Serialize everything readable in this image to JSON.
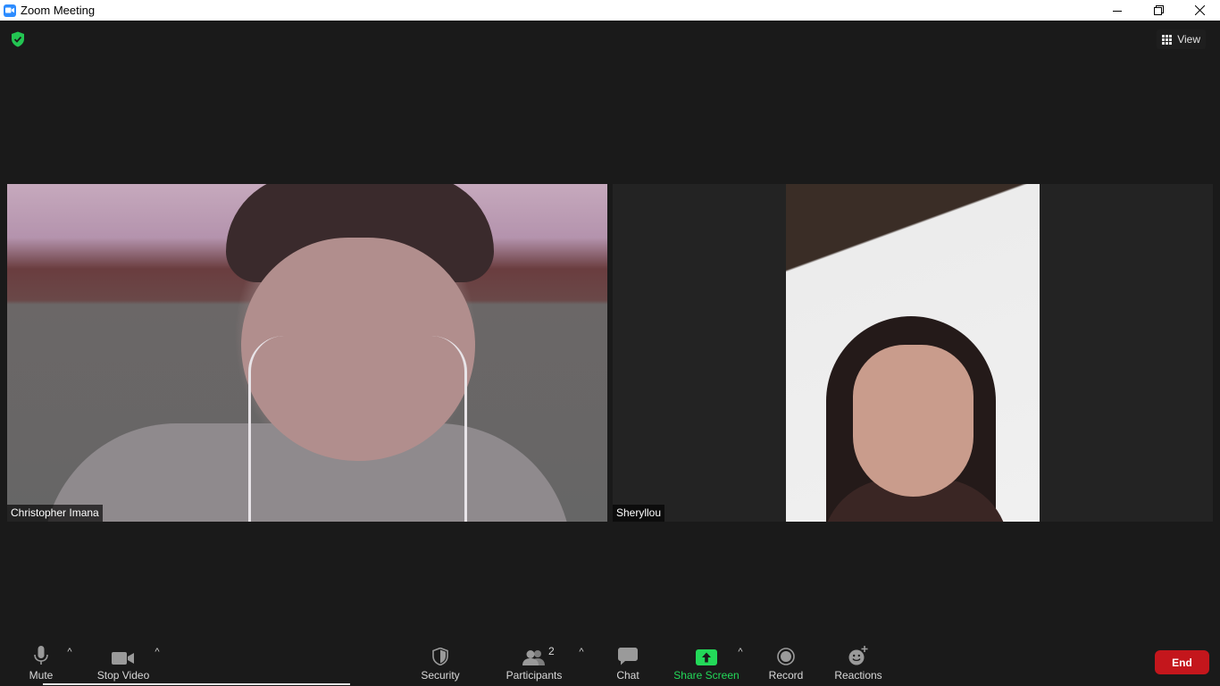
{
  "window": {
    "title": "Zoom Meeting",
    "controls": [
      "minimize-icon",
      "restore-icon",
      "close-icon"
    ]
  },
  "header": {
    "view_label": "View",
    "encryption_badge": "shield-check-icon"
  },
  "participants": [
    {
      "name": "Christopher Imana"
    },
    {
      "name": "Sheryllou"
    }
  ],
  "toolbar": {
    "mute_label": "Mute",
    "stop_video_label": "Stop Video",
    "security_label": "Security",
    "participants_label": "Participants",
    "participants_count": "2",
    "chat_label": "Chat",
    "share_screen_label": "Share Screen",
    "record_label": "Record",
    "reactions_label": "Reactions",
    "end_label": "End",
    "caret": "^"
  },
  "colors": {
    "background": "#1a1a1a",
    "share_screen_green": "#23d959",
    "end_red": "#c4161c",
    "zoom_blue": "#2d8cff",
    "secure_green": "#23c552"
  }
}
